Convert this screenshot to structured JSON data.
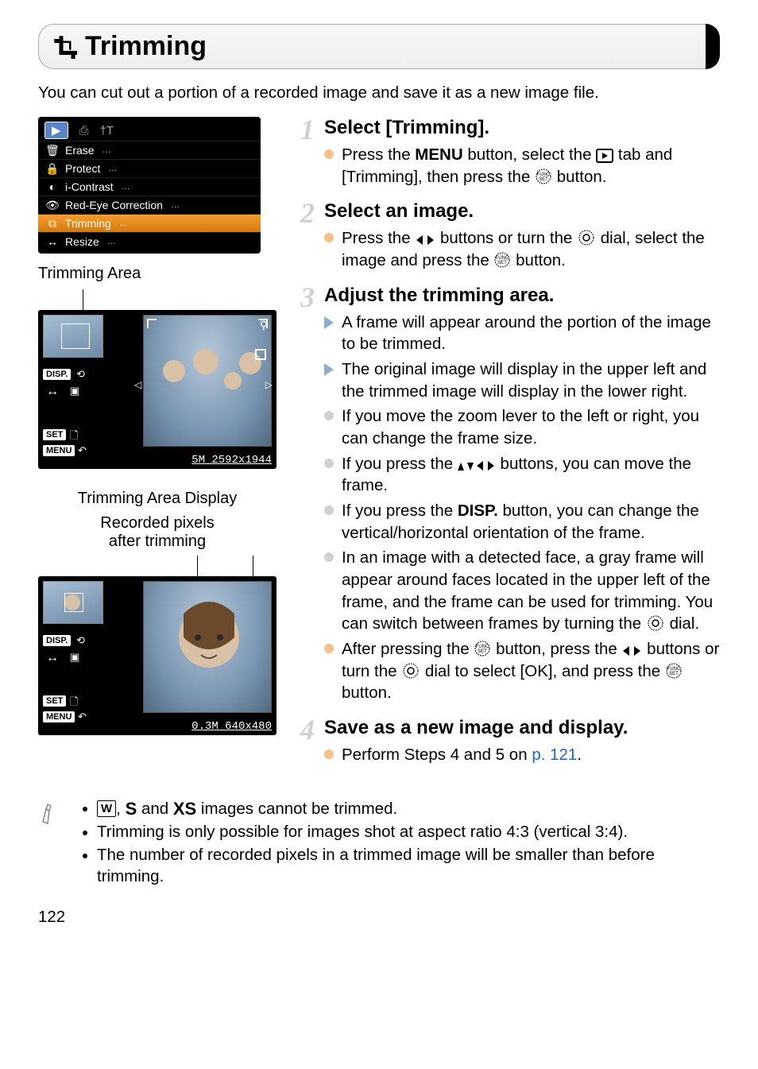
{
  "title": "Trimming",
  "intro": "You can cut out a portion of a recorded image and save it as a new image file.",
  "menu": {
    "items": [
      {
        "label": "Erase"
      },
      {
        "label": "Protect"
      },
      {
        "label": "i-Contrast"
      },
      {
        "label": "Red-Eye Correction"
      },
      {
        "label": "Trimming",
        "selected": true
      },
      {
        "label": "Resize"
      }
    ]
  },
  "left": {
    "trimming_area_caption": "Trimming Area",
    "trimming_area_display_caption": "Trimming Area Display",
    "recorded_pixels_caption_l1": "Recorded pixels",
    "recorded_pixels_caption_l2": "after trimming",
    "res1": "5M 2592x1944",
    "res2": "0.3M 640x480",
    "disp_label": "DISP.",
    "set_label": "SET",
    "menu_label": "MENU"
  },
  "steps": [
    {
      "num": "1",
      "title": "Select [Trimming].",
      "items": [
        {
          "type": "orange",
          "html": "Press the <b>MENU</b> button, select the {PLAYTAB} tab and [Trimming], then press the {FUNC} button."
        }
      ]
    },
    {
      "num": "2",
      "title": "Select an image.",
      "items": [
        {
          "type": "orange",
          "html": "Press the {LR} buttons or turn the {DIAL} dial, select the image and press the {FUNC} button."
        }
      ]
    },
    {
      "num": "3",
      "title": "Adjust the trimming area.",
      "items": [
        {
          "type": "tri",
          "html": "A frame will appear around the portion of the image to be trimmed."
        },
        {
          "type": "tri",
          "html": "The original image will display in the upper left and the trimmed image will display in the lower right."
        },
        {
          "type": "gray",
          "html": "If you move the zoom lever to the left or right, you can change the frame size."
        },
        {
          "type": "gray",
          "html": "If you press the {UDLR} buttons, you can move the frame."
        },
        {
          "type": "gray",
          "html": "If you press the <b>DISP.</b> button, you can change the vertical/horizontal orientation of the frame."
        },
        {
          "type": "gray",
          "html": "In an image with a detected face, a gray frame will appear around faces located in the upper left of the frame, and the frame can be used for trimming. You can switch between frames by turning the {DIAL} dial."
        },
        {
          "type": "orange",
          "html": "After pressing the {FUNC} button, press the {LR} buttons or turn the {DIAL} dial to select [OK], and press the {FUNC} button."
        }
      ]
    },
    {
      "num": "4",
      "title": "Save as a new image and display.",
      "items": [
        {
          "type": "orange",
          "html": "Perform Steps 4 and 5 on <span class=\"link\">p. 121</span>."
        }
      ]
    }
  ],
  "notes": [
    "{W}, {S} and {XS} images cannot be trimmed.",
    "Trimming is only possible for images shot at aspect ratio 4:3 (vertical 3:4).",
    "The number of recorded pixels in a trimmed image will be smaller than before trimming."
  ],
  "page_number": "122"
}
